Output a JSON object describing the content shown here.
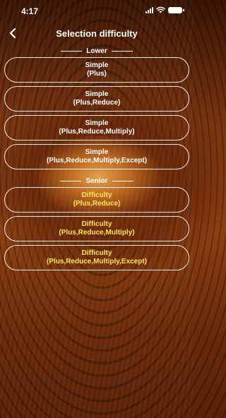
{
  "status_bar": {
    "time": "4:17"
  },
  "nav": {
    "title": "Selection difficulty"
  },
  "sections": {
    "lower": {
      "label": "Lower",
      "options": [
        {
          "line1": "Simple",
          "line2": "(Plus)"
        },
        {
          "line1": "Simple",
          "line2": "(Plus,Reduce)"
        },
        {
          "line1": "Simple",
          "line2": "(Plus,Reduce,Multiply)"
        },
        {
          "line1": "Simple",
          "line2": "(Plus,Reduce,Multiply,Except)"
        }
      ]
    },
    "senior": {
      "label": "Senior",
      "options": [
        {
          "line1": "Difficulty",
          "line2": "(Plus,Reduce)"
        },
        {
          "line1": "Difficulty",
          "line2": "(Plus,Reduce,Multiply)"
        },
        {
          "line1": "Difficulty",
          "line2": "(Plus,Reduce,Multiply,Except)"
        }
      ]
    }
  },
  "colors": {
    "highlight_text": "#ffe45c",
    "border": "#ffffff"
  }
}
